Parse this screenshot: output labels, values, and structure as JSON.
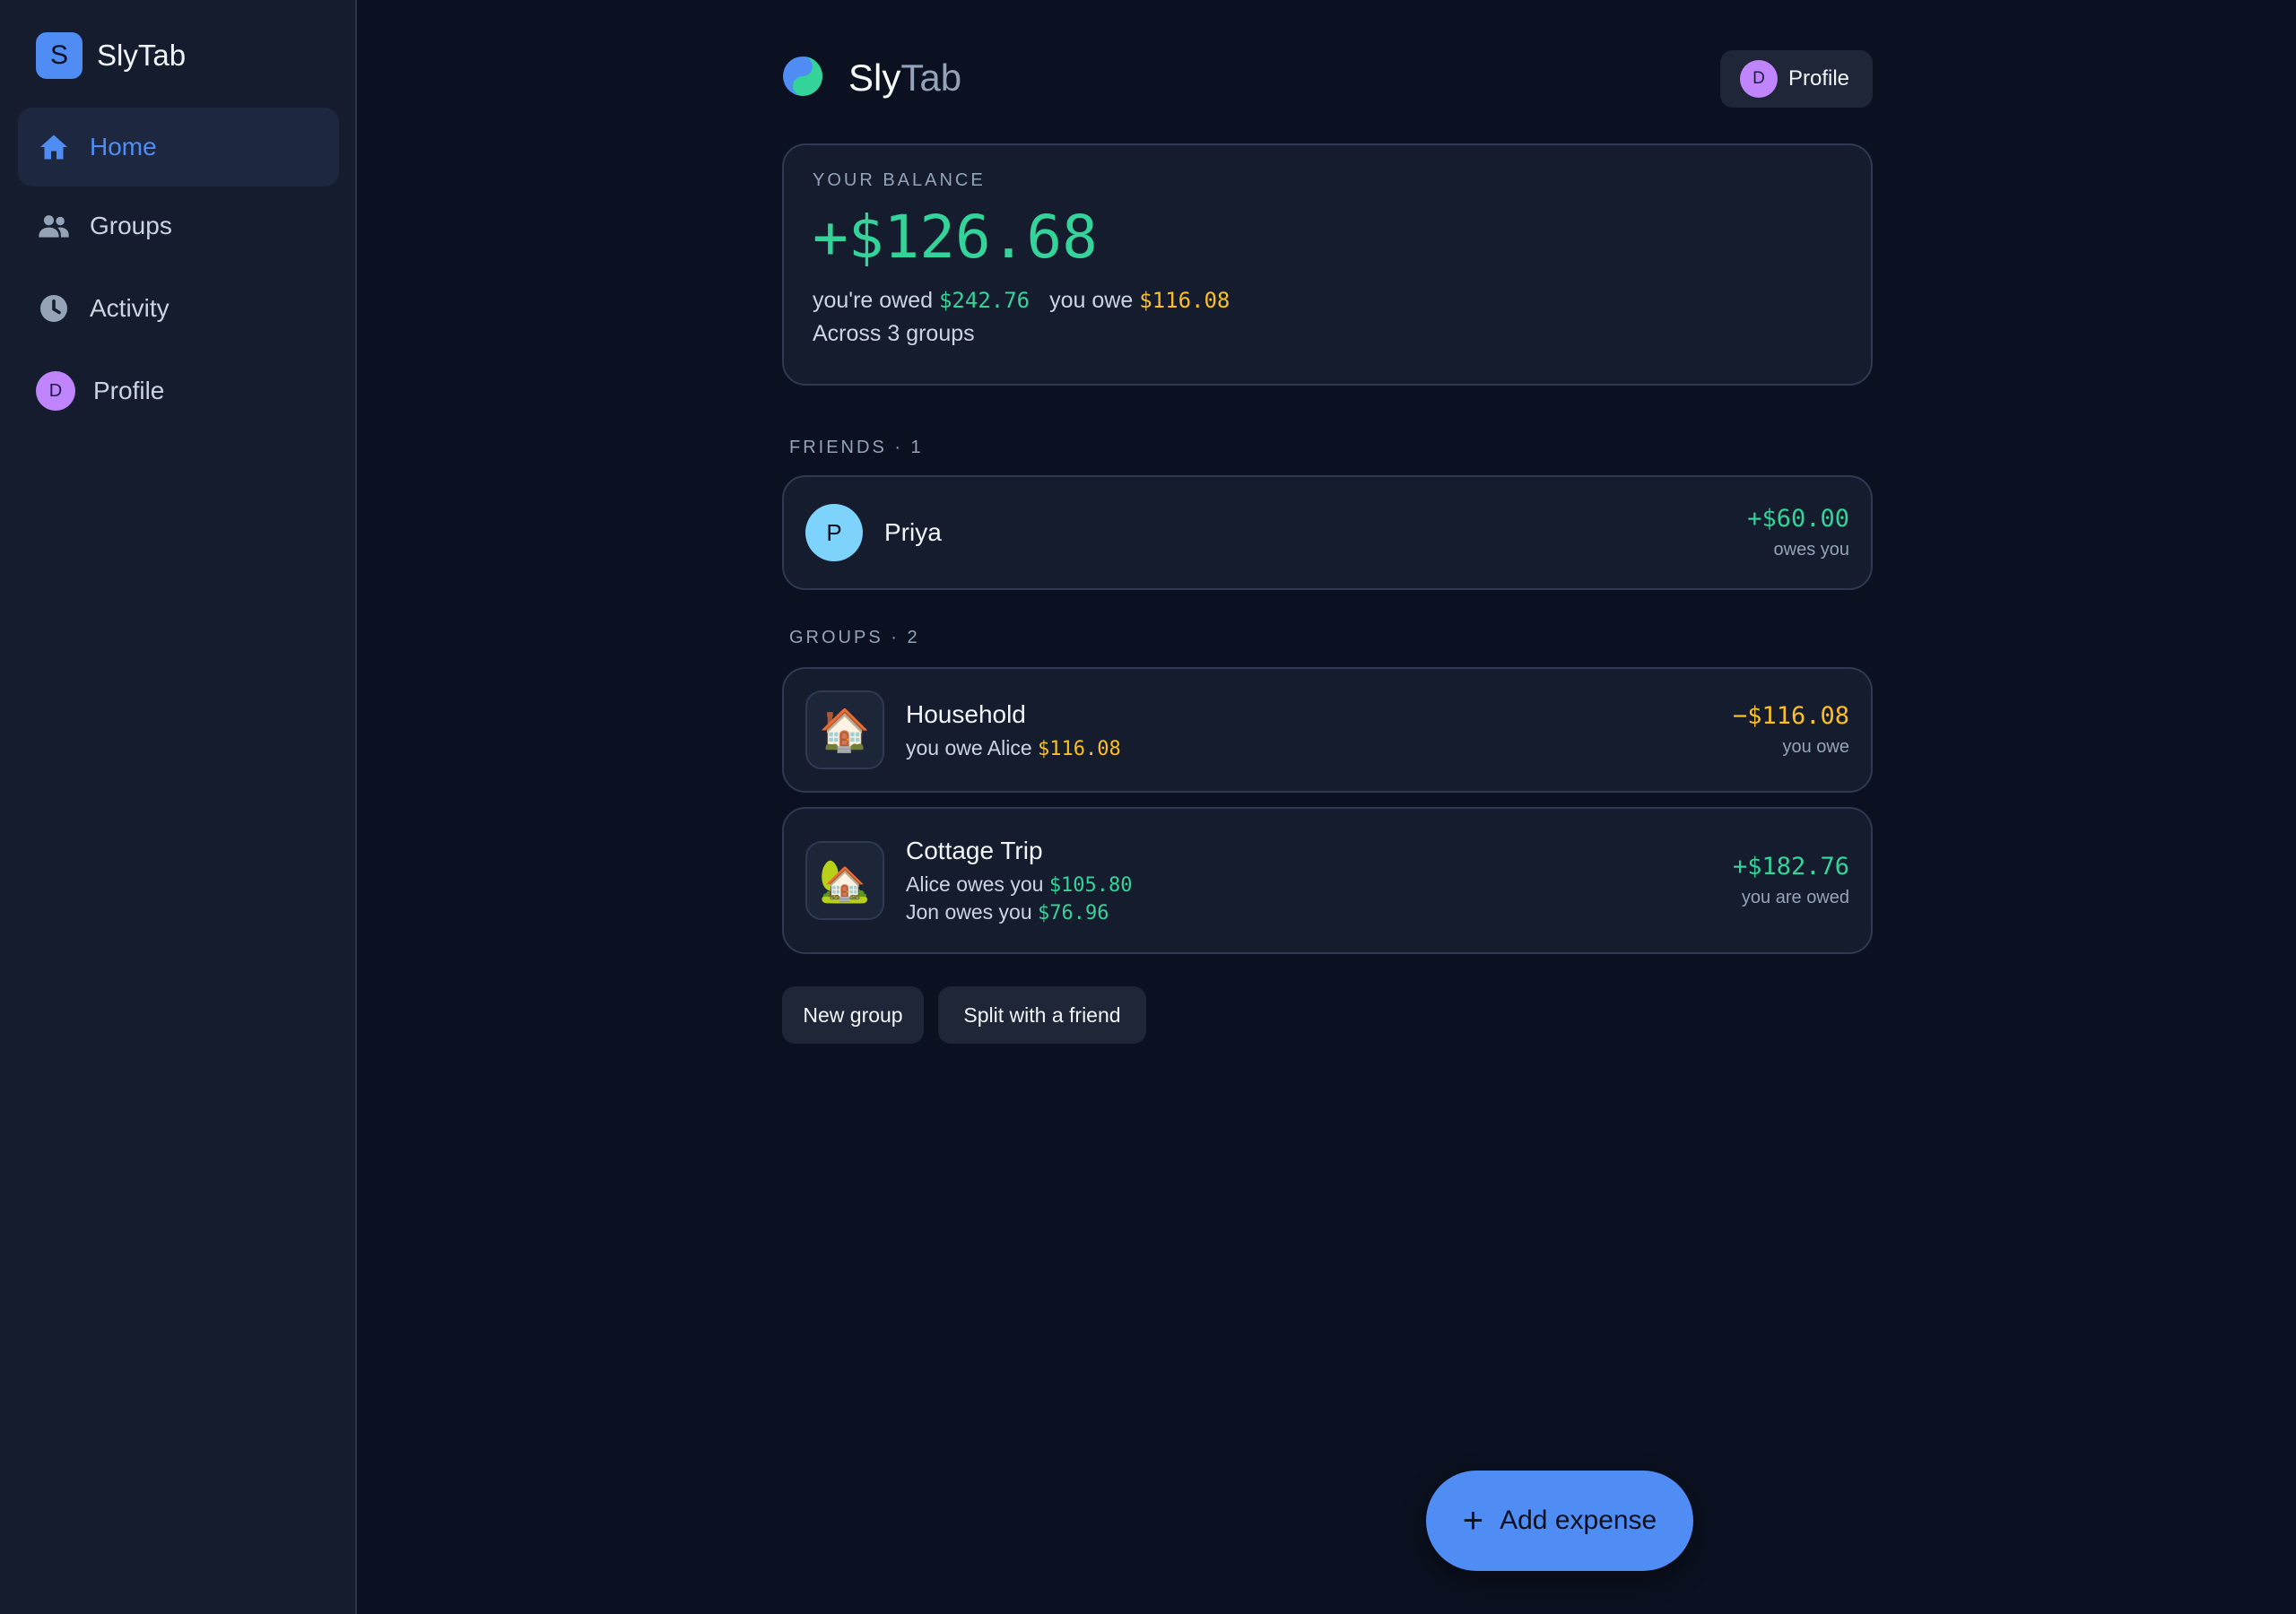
{
  "sidebar": {
    "logo_letter": "S",
    "brand": "SlyTab",
    "items": [
      {
        "label": "Home",
        "icon": "home-icon",
        "active": true
      },
      {
        "label": "Groups",
        "icon": "people-icon",
        "active": false
      },
      {
        "label": "Activity",
        "icon": "clock-icon",
        "active": false
      },
      {
        "label": "Profile",
        "icon": "avatar",
        "avatar_letter": "D",
        "active": false
      }
    ]
  },
  "header": {
    "brand_primary": "Sly",
    "brand_secondary": "Tab",
    "profile": {
      "avatar_letter": "D",
      "label": "Profile"
    }
  },
  "balance": {
    "eyebrow": "YOUR BALANCE",
    "amount": "+$126.68",
    "owed_label": "you're owed",
    "owed_amount": "$242.76",
    "owe_label": "you owe",
    "owe_amount": "$116.08",
    "subtitle": "Across 3 groups"
  },
  "friends": {
    "label": "FRIENDS · 1",
    "items": [
      {
        "avatar_letter": "P",
        "name": "Priya",
        "amount": "+$60.00",
        "note": "owes you"
      }
    ]
  },
  "groups": {
    "label": "GROUPS · 2",
    "items": [
      {
        "icon": "🏠",
        "name": "Household",
        "lines": [
          {
            "text": "you owe Alice",
            "amount": "$116.08"
          }
        ],
        "amount": "−$116.08",
        "note": "you owe"
      },
      {
        "icon": "🏡",
        "name": "Cottage Trip",
        "lines": [
          {
            "text": "Alice owes you",
            "amount": "$105.80"
          },
          {
            "text": "Jon owes you",
            "amount": "$76.96"
          }
        ],
        "amount": "+$182.76",
        "note": "you are owed"
      }
    ]
  },
  "actions": {
    "new_group": "New group",
    "split_friend": "Split with a friend"
  },
  "fab": {
    "plus": "+",
    "label": "Add expense"
  },
  "colors": {
    "background": "#0b1120",
    "sidebar": "#151c2e",
    "accent": "#4f8df5",
    "positive": "#34d399",
    "negative": "#fbbf24",
    "avatar_d": "#c084fc",
    "avatar_p": "#7dd3fc"
  }
}
